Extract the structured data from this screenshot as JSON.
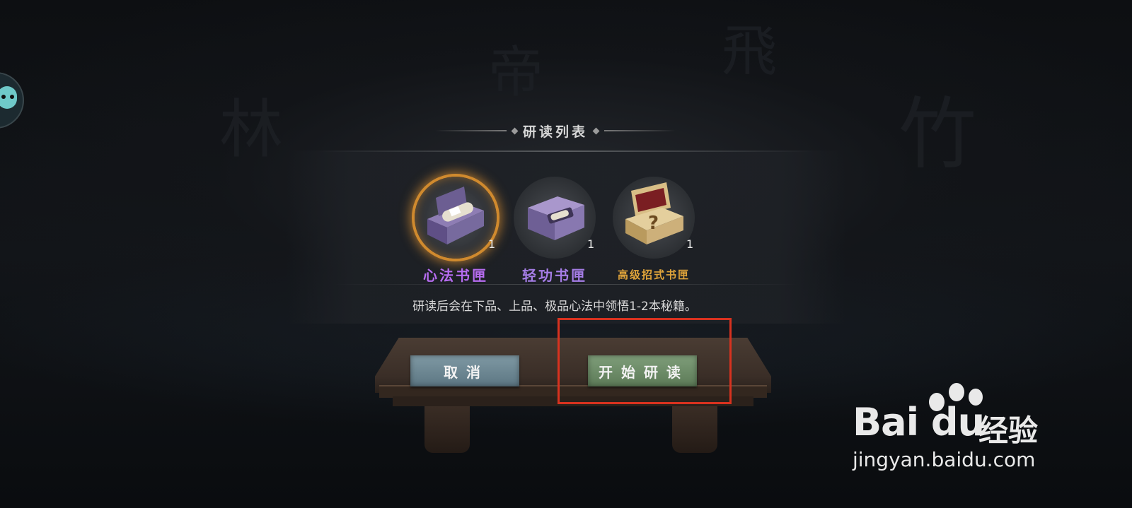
{
  "dialog": {
    "title": "研读列表",
    "items": [
      {
        "name": "心法书匣",
        "count": "1",
        "color": "#b66cf0",
        "selected": true,
        "icon": "purple-scroll-box-icon"
      },
      {
        "name": "轻功书匣",
        "count": "1",
        "color": "#a57de6",
        "selected": false,
        "icon": "purple-chest-icon"
      },
      {
        "name": "高级招式书匣",
        "count": "1",
        "color": "#e0a43a",
        "selected": false,
        "icon": "gold-chest-icon"
      }
    ],
    "description": "研读后会在下品、上品、极品心法中领悟1-2本秘籍。",
    "cancel_label": "取消",
    "start_label": "开始研读"
  },
  "watermark": {
    "brand": "Bai du",
    "product": "经验",
    "url": "jingyan.baidu.com"
  },
  "colors": {
    "cancel_button": "#6f8994",
    "start_button": "#6e8d69",
    "highlight_border": "#d8321f",
    "selected_glow": "#d08a2e"
  }
}
